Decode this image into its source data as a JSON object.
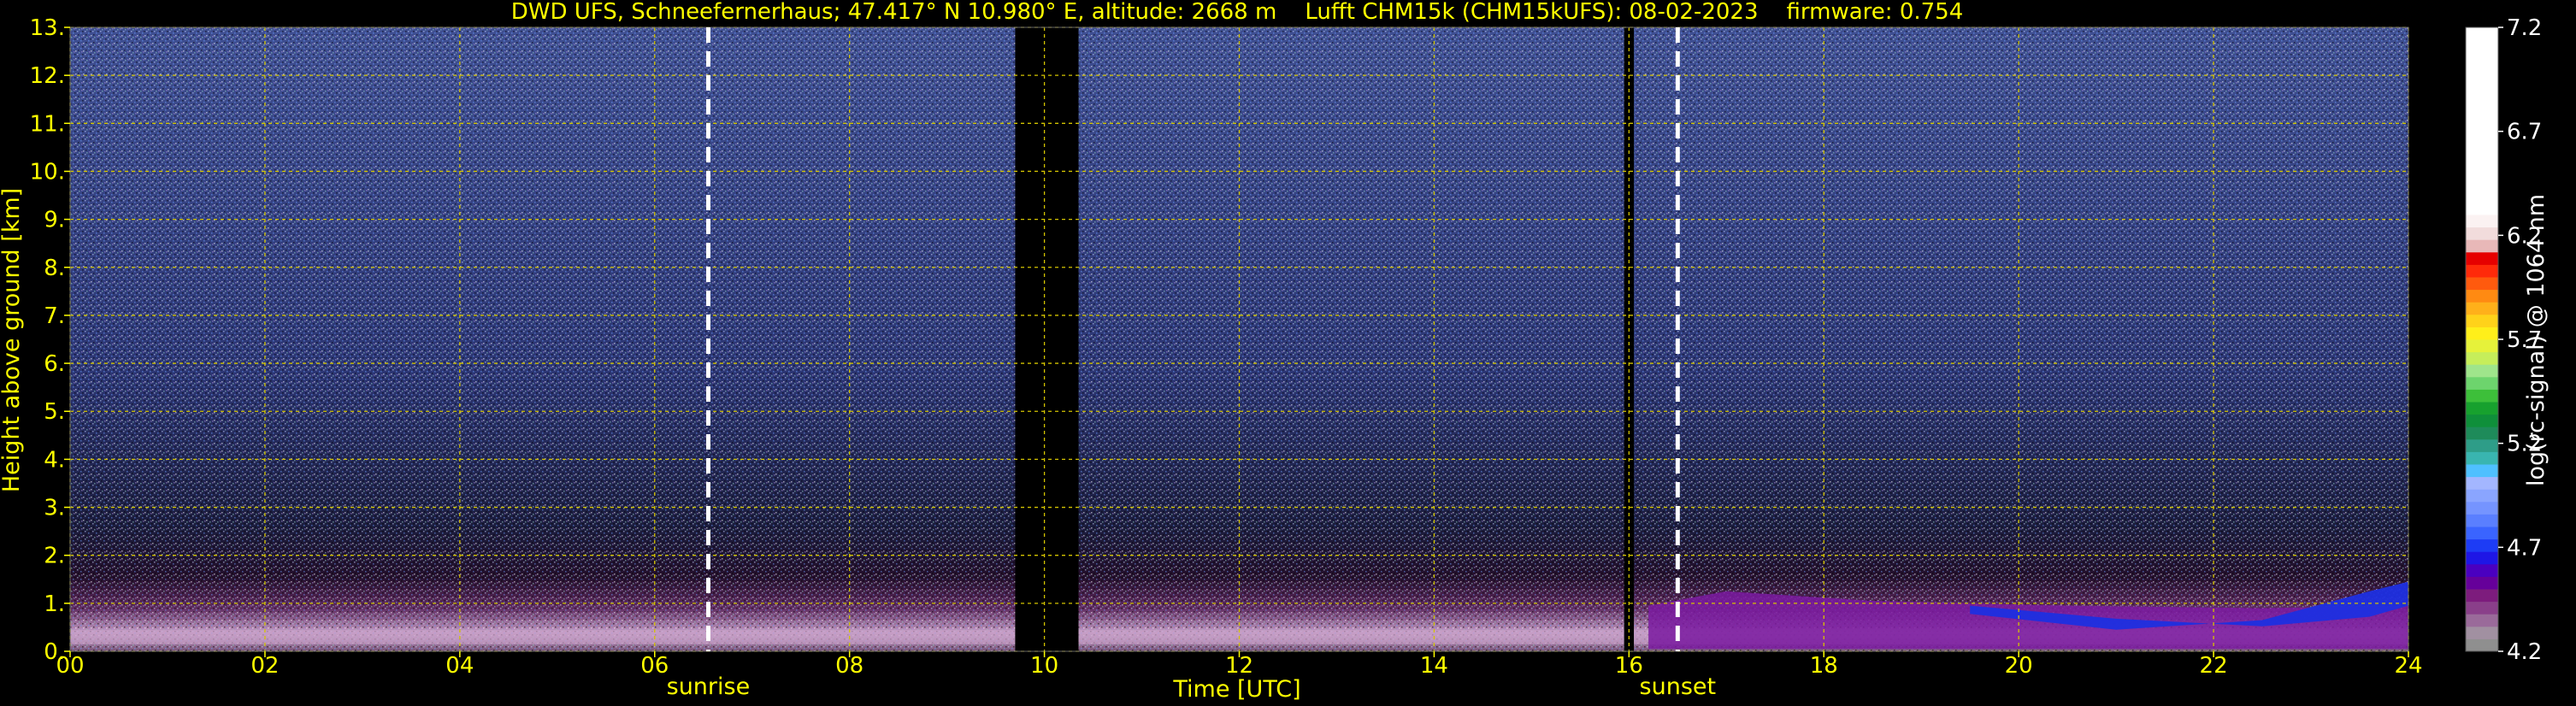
{
  "chart_data": {
    "type": "heatmap",
    "title": "DWD UFS, Schneefernerhaus; 47.417° N 10.980° E, altitude: 2668 m    Lufft CHM15k (CHM15kUFS): 08-02-2023    firmware: 0.754",
    "xlabel": "Time [UTC]",
    "ylabel": "Height above ground [km]",
    "xlim": [
      0,
      24
    ],
    "ylim": [
      0,
      13
    ],
    "x_ticks": [
      "00",
      "02",
      "04",
      "06",
      "08",
      "10",
      "12",
      "14",
      "16",
      "18",
      "20",
      "22",
      "24"
    ],
    "y_ticks": [
      "0.",
      "1.",
      "2.",
      "3.",
      "4.",
      "5.",
      "6.",
      "7.",
      "8.",
      "9.",
      "10.",
      "11.",
      "12.",
      "13."
    ],
    "grid": true,
    "colorbar": {
      "label": "log(rc-signal) @ 1064 nm",
      "range": [
        4.2,
        7.2
      ],
      "ticks": [
        "4.2",
        "4.7",
        "5.2",
        "5.7",
        "6.2",
        "6.7",
        "7.2"
      ]
    },
    "annotations": [
      {
        "text": "sunrise",
        "x": 6.55
      },
      {
        "text": "sunset",
        "x": 16.5
      }
    ],
    "missing_data_intervals": [
      [
        9.7,
        10.35
      ],
      [
        15.95,
        16.05
      ]
    ],
    "colors": {
      "background": "#000000",
      "text": "#ffff00",
      "grid": "#d4c400",
      "marker_lines": "#ffffff"
    }
  }
}
